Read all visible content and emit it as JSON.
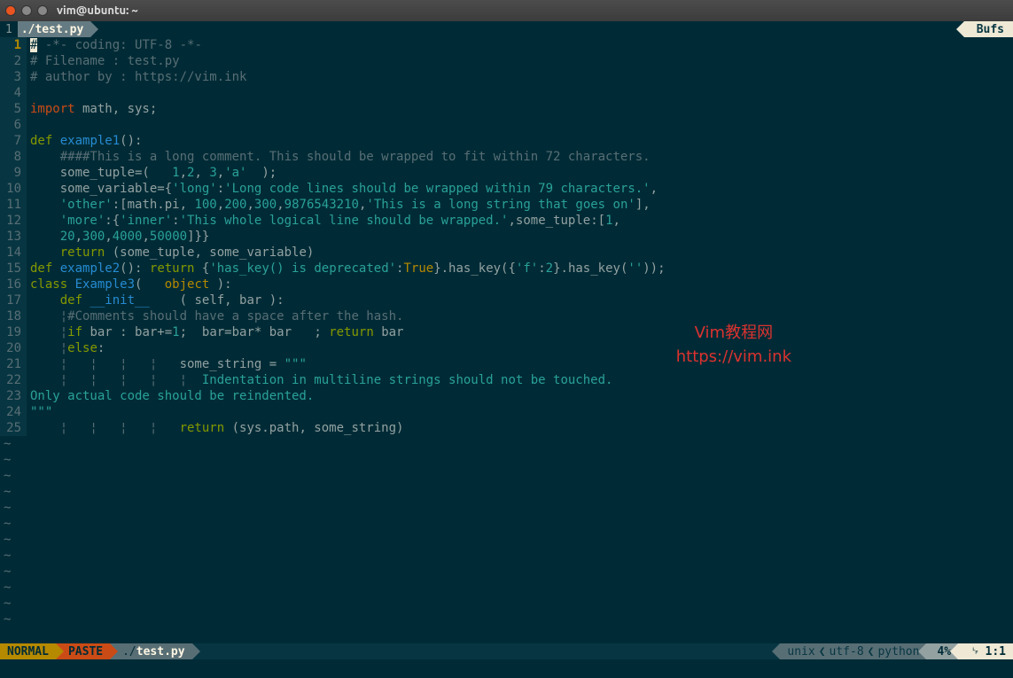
{
  "window": {
    "title": "vim@ubuntu: ~"
  },
  "tabline": {
    "index": "1",
    "file": "./test.py",
    "bufs": "Bufs"
  },
  "lines": [
    {
      "n": 1,
      "spans": [
        {
          "t": "# ",
          "c": "c-comment cursor-wrap",
          "cursor": true
        },
        {
          "t": "-*- coding: UTF-8 -*-",
          "c": "c-comment"
        }
      ]
    },
    {
      "n": 2,
      "spans": [
        {
          "t": "# Filename : test.py",
          "c": "c-comment"
        }
      ]
    },
    {
      "n": 3,
      "spans": [
        {
          "t": "# author by : https://vim.ink",
          "c": "c-comment"
        }
      ]
    },
    {
      "n": 4,
      "spans": []
    },
    {
      "n": 5,
      "spans": [
        {
          "t": "import",
          "c": "c-import"
        },
        {
          "t": " math, sys;",
          "c": "c-ident"
        }
      ]
    },
    {
      "n": 6,
      "spans": []
    },
    {
      "n": 7,
      "spans": [
        {
          "t": "def",
          "c": "c-keyword"
        },
        {
          "t": " ",
          "c": ""
        },
        {
          "t": "example1",
          "c": "c-func"
        },
        {
          "t": "():",
          "c": "c-punc"
        }
      ]
    },
    {
      "n": 8,
      "spans": [
        {
          "t": "    ",
          "c": ""
        },
        {
          "t": "####This is a long comment. This should be wrapped to fit within 72 characters.",
          "c": "c-comment"
        }
      ]
    },
    {
      "n": 9,
      "spans": [
        {
          "t": "    some_tuple=(   ",
          "c": "c-ident"
        },
        {
          "t": "1",
          "c": "c-number"
        },
        {
          "t": ",",
          "c": "c-punc"
        },
        {
          "t": "2",
          "c": "c-number"
        },
        {
          "t": ", ",
          "c": "c-punc"
        },
        {
          "t": "3",
          "c": "c-number"
        },
        {
          "t": ",",
          "c": "c-punc"
        },
        {
          "t": "'a'",
          "c": "c-string"
        },
        {
          "t": "  );",
          "c": "c-punc"
        }
      ]
    },
    {
      "n": 10,
      "spans": [
        {
          "t": "    some_variable={",
          "c": "c-ident"
        },
        {
          "t": "'long'",
          "c": "c-string"
        },
        {
          "t": ":",
          "c": "c-punc"
        },
        {
          "t": "'Long code lines should be wrapped within 79 characters.'",
          "c": "c-string"
        },
        {
          "t": ",",
          "c": "c-punc"
        }
      ]
    },
    {
      "n": 11,
      "spans": [
        {
          "t": "    ",
          "c": ""
        },
        {
          "t": "'other'",
          "c": "c-string"
        },
        {
          "t": ":[math.pi, ",
          "c": "c-ident"
        },
        {
          "t": "100",
          "c": "c-number"
        },
        {
          "t": ",",
          "c": "c-punc"
        },
        {
          "t": "200",
          "c": "c-number"
        },
        {
          "t": ",",
          "c": "c-punc"
        },
        {
          "t": "300",
          "c": "c-number"
        },
        {
          "t": ",",
          "c": "c-punc"
        },
        {
          "t": "9876543210",
          "c": "c-number"
        },
        {
          "t": ",",
          "c": "c-punc"
        },
        {
          "t": "'This is a long string that goes on'",
          "c": "c-string"
        },
        {
          "t": "],",
          "c": "c-punc"
        }
      ]
    },
    {
      "n": 12,
      "spans": [
        {
          "t": "    ",
          "c": ""
        },
        {
          "t": "'more'",
          "c": "c-string"
        },
        {
          "t": ":{",
          "c": "c-punc"
        },
        {
          "t": "'inner'",
          "c": "c-string"
        },
        {
          "t": ":",
          "c": "c-punc"
        },
        {
          "t": "'This whole logical line should be wrapped.'",
          "c": "c-string"
        },
        {
          "t": ",some_tuple:[",
          "c": "c-ident"
        },
        {
          "t": "1",
          "c": "c-number"
        },
        {
          "t": ",",
          "c": "c-punc"
        }
      ]
    },
    {
      "n": 13,
      "spans": [
        {
          "t": "    ",
          "c": ""
        },
        {
          "t": "20",
          "c": "c-number"
        },
        {
          "t": ",",
          "c": "c-punc"
        },
        {
          "t": "300",
          "c": "c-number"
        },
        {
          "t": ",",
          "c": "c-punc"
        },
        {
          "t": "4000",
          "c": "c-number"
        },
        {
          "t": ",",
          "c": "c-punc"
        },
        {
          "t": "50000",
          "c": "c-number"
        },
        {
          "t": "]}}",
          "c": "c-punc"
        }
      ]
    },
    {
      "n": 14,
      "spans": [
        {
          "t": "    ",
          "c": ""
        },
        {
          "t": "return",
          "c": "c-keyword"
        },
        {
          "t": " (some_tuple, some_variable)",
          "c": "c-ident"
        }
      ]
    },
    {
      "n": 15,
      "spans": [
        {
          "t": "def",
          "c": "c-keyword"
        },
        {
          "t": " ",
          "c": ""
        },
        {
          "t": "example2",
          "c": "c-func"
        },
        {
          "t": "(): ",
          "c": "c-punc"
        },
        {
          "t": "return",
          "c": "c-keyword"
        },
        {
          "t": " {",
          "c": "c-punc"
        },
        {
          "t": "'has_key() is deprecated'",
          "c": "c-string"
        },
        {
          "t": ":",
          "c": "c-punc"
        },
        {
          "t": "True",
          "c": "c-const"
        },
        {
          "t": "}.has_key({",
          "c": "c-ident"
        },
        {
          "t": "'f'",
          "c": "c-string"
        },
        {
          "t": ":",
          "c": "c-punc"
        },
        {
          "t": "2",
          "c": "c-number"
        },
        {
          "t": "}.has_key(",
          "c": "c-ident"
        },
        {
          "t": "''",
          "c": "c-string"
        },
        {
          "t": "));",
          "c": "c-punc"
        }
      ]
    },
    {
      "n": 16,
      "spans": [
        {
          "t": "class",
          "c": "c-keyword"
        },
        {
          "t": " ",
          "c": ""
        },
        {
          "t": "Example3",
          "c": "c-class"
        },
        {
          "t": "(   ",
          "c": "c-punc"
        },
        {
          "t": "object",
          "c": "c-builtin"
        },
        {
          "t": " ):",
          "c": "c-punc"
        }
      ]
    },
    {
      "n": 17,
      "spans": [
        {
          "t": "    ",
          "c": ""
        },
        {
          "t": "def",
          "c": "c-keyword"
        },
        {
          "t": " ",
          "c": ""
        },
        {
          "t": "__init__",
          "c": "c-func"
        },
        {
          "t": "    ( self, bar ):",
          "c": "c-ident"
        }
      ]
    },
    {
      "n": 18,
      "spans": [
        {
          "t": "    ",
          "c": ""
        },
        {
          "t": "¦",
          "c": "indent"
        },
        {
          "t": "#Comments should have a space after the hash.",
          "c": "c-comment"
        }
      ]
    },
    {
      "n": 19,
      "spans": [
        {
          "t": "    ",
          "c": ""
        },
        {
          "t": "¦",
          "c": "indent"
        },
        {
          "t": "if",
          "c": "c-keyword"
        },
        {
          "t": " bar : bar+=",
          "c": "c-ident"
        },
        {
          "t": "1",
          "c": "c-number"
        },
        {
          "t": ";  bar=bar* bar   ; ",
          "c": "c-ident"
        },
        {
          "t": "return",
          "c": "c-keyword"
        },
        {
          "t": " bar",
          "c": "c-ident"
        }
      ]
    },
    {
      "n": 20,
      "spans": [
        {
          "t": "    ",
          "c": ""
        },
        {
          "t": "¦",
          "c": "indent"
        },
        {
          "t": "else",
          "c": "c-keyword"
        },
        {
          "t": ":",
          "c": "c-punc"
        }
      ]
    },
    {
      "n": 21,
      "spans": [
        {
          "t": "    ",
          "c": ""
        },
        {
          "t": "¦   ¦   ¦   ¦   ",
          "c": "indent"
        },
        {
          "t": "some_string = ",
          "c": "c-ident"
        },
        {
          "t": "\"\"\"",
          "c": "c-string"
        }
      ]
    },
    {
      "n": 22,
      "spans": [
        {
          "t": "    ",
          "c": ""
        },
        {
          "t": "¦   ¦   ¦   ¦   ¦  ",
          "c": "indent"
        },
        {
          "t": "Indentation in multiline strings should not be touched.",
          "c": "c-string"
        }
      ]
    },
    {
      "n": 23,
      "spans": [
        {
          "t": "Only actual code should be reindented.",
          "c": "c-string"
        }
      ]
    },
    {
      "n": 24,
      "spans": [
        {
          "t": "\"\"\"",
          "c": "c-string"
        }
      ]
    },
    {
      "n": 25,
      "spans": [
        {
          "t": "    ",
          "c": ""
        },
        {
          "t": "¦   ¦   ¦   ¦   ",
          "c": "indent"
        },
        {
          "t": "return",
          "c": "c-keyword"
        },
        {
          "t": " (sys.path, some_string)",
          "c": "c-ident"
        }
      ]
    }
  ],
  "tilde_count": 12,
  "statusline": {
    "mode": "NORMAL",
    "paste": "PASTE",
    "file_prefix": "./",
    "file_name": "test.py",
    "fileformat": "unix",
    "encoding": "utf-8",
    "filetype": "python",
    "percent": "4%",
    "position": "1:1"
  },
  "watermark": {
    "line1": "Vim教程网",
    "line2": "https://vim.ink"
  }
}
